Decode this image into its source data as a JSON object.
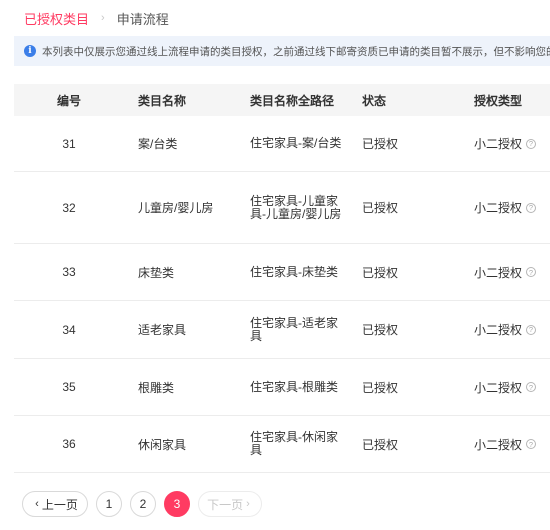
{
  "breadcrumb": {
    "active": "已授权类目",
    "separator": "›",
    "next": "申请流程"
  },
  "notice": {
    "icon": "info-icon",
    "icon_glyph": "i",
    "text": "本列表中仅展示您通过线上流程申请的类目授权，之前通过线下邮寄资质已申请的类目暂不展示，但不影响您的类目授权和商"
  },
  "table": {
    "headers": {
      "id": "编号",
      "name": "类目名称",
      "path": "类目名称全路径",
      "status": "状态",
      "auth_type": "授权类型"
    },
    "rows": [
      {
        "id": "31",
        "name": "案/台类",
        "path": "住宅家具-案/台类",
        "status": "已授权",
        "auth_type": "小二授权"
      },
      {
        "id": "32",
        "name": "儿童房/婴儿房",
        "path": "住宅家具-儿童家具-儿童房/婴儿房",
        "status": "已授权",
        "auth_type": "小二授权"
      },
      {
        "id": "33",
        "name": "床垫类",
        "path": "住宅家具-床垫类",
        "status": "已授权",
        "auth_type": "小二授权"
      },
      {
        "id": "34",
        "name": "适老家具",
        "path": "住宅家具-适老家具",
        "status": "已授权",
        "auth_type": "小二授权"
      },
      {
        "id": "35",
        "name": "根雕类",
        "path": "住宅家具-根雕类",
        "status": "已授权",
        "auth_type": "小二授权"
      },
      {
        "id": "36",
        "name": "休闲家具",
        "path": "住宅家具-休闲家具",
        "status": "已授权",
        "auth_type": "小二授权"
      }
    ]
  },
  "pagination": {
    "prev_label": "上一页",
    "next_label": "下一页",
    "pages": [
      "1",
      "2",
      "3"
    ],
    "current": "3",
    "next_disabled": true
  },
  "colors": {
    "accent": "#ff3b62",
    "notice_bg": "#eef3fb",
    "info_icon": "#3b7ee8"
  }
}
